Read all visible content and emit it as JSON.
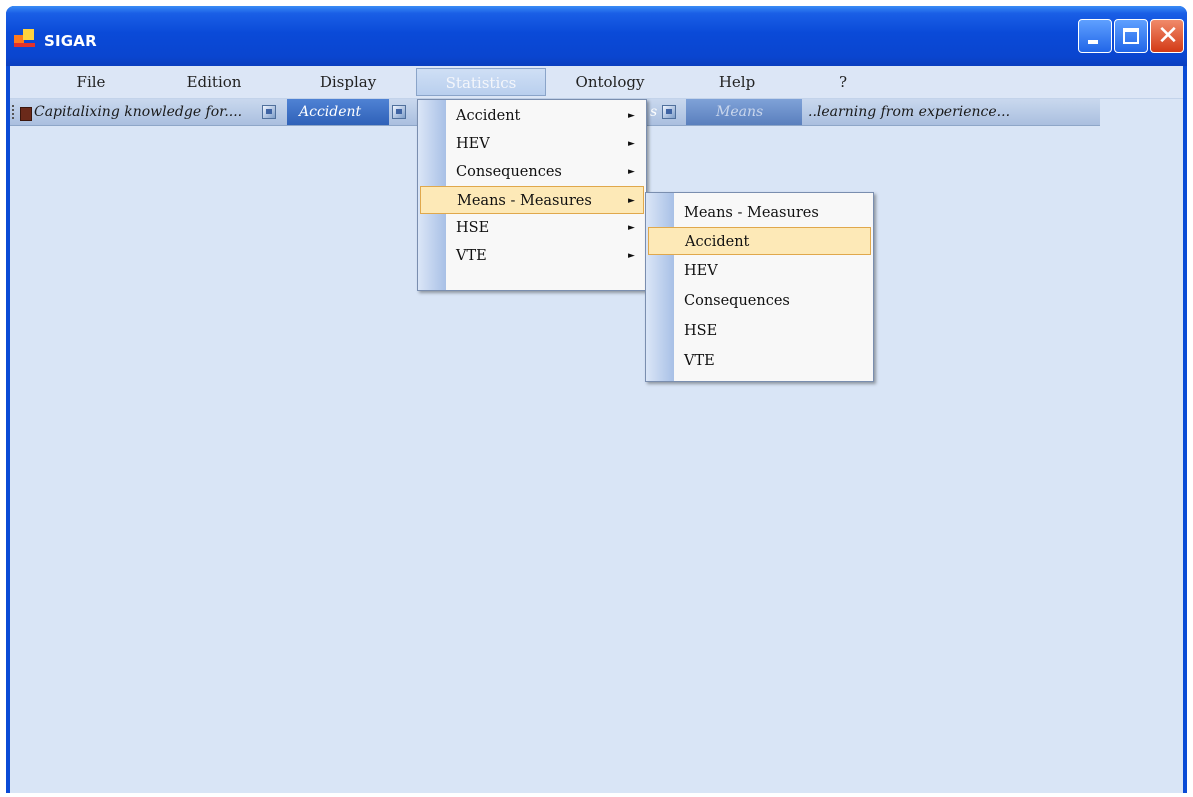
{
  "window": {
    "title": "SIGAR",
    "icon": "sigar-app-icon",
    "controls": {
      "minimize": "minimize-icon",
      "maximize": "maximize-icon",
      "close": "close-icon",
      "close_glyph": "✕"
    }
  },
  "menubar": {
    "items": [
      "File",
      "Edition",
      "Display",
      "Statistics",
      "Ontology",
      "Help",
      "?"
    ],
    "active": "Statistics"
  },
  "toolbar": {
    "label_left": "Capitalixing knowledge for....",
    "accident": "Accident",
    "hidden_fragment": "s",
    "means": "Means",
    "label_right": "..learning from experience...",
    "icons": [
      "book-icon",
      "image-icon",
      "image-icon",
      "image-icon"
    ]
  },
  "statistics_menu": {
    "items": [
      "Accident",
      "HEV",
      "Consequences",
      "Means - Measures",
      "HSE",
      "VTE"
    ],
    "highlighted": "Means - Measures",
    "arrow_glyph": "►"
  },
  "means_submenu": {
    "items": [
      "Means - Measures",
      "Accident",
      "HEV",
      "Consequences",
      "HSE",
      "VTE"
    ],
    "highlighted": "Accident"
  },
  "colors": {
    "titlebar": "#0a4ad8",
    "client": "#d9e5f6",
    "highlight": "#fde9b7",
    "highlight_border": "#e0a84c"
  }
}
